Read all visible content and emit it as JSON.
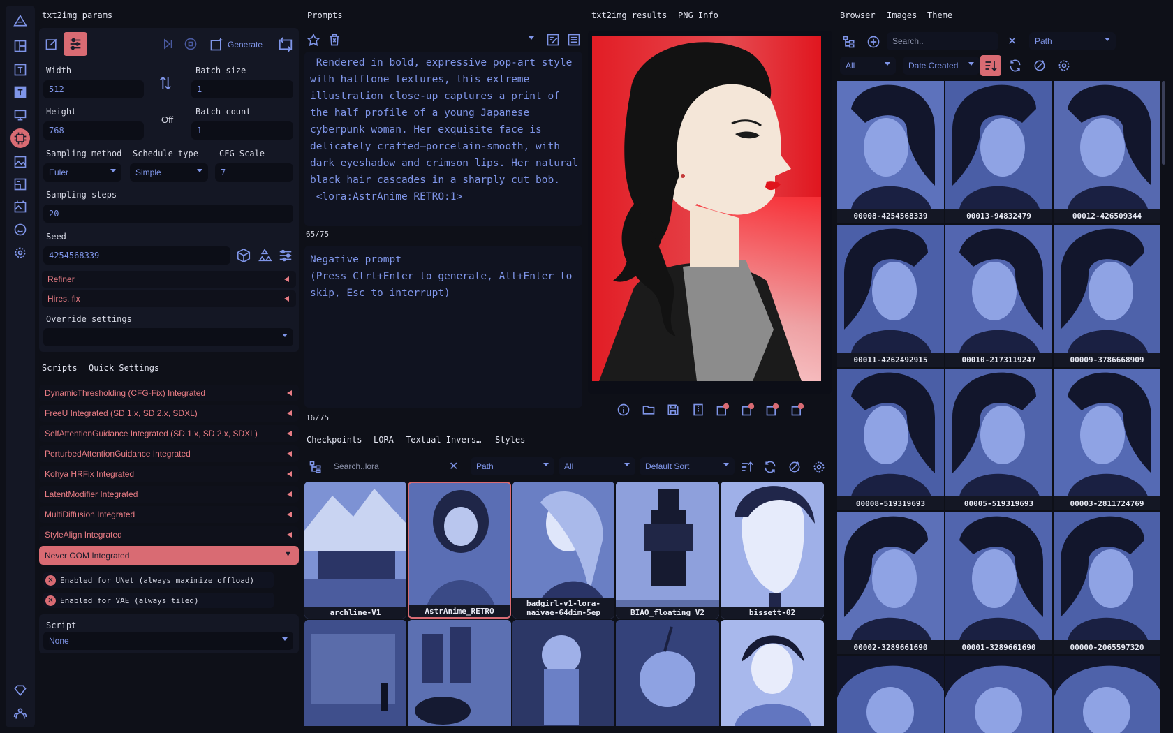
{
  "params": {
    "title": "txt2img params",
    "generate": "Generate",
    "width_label": "Width",
    "width": "512",
    "height_label": "Height",
    "height": "768",
    "batch_size_label": "Batch size",
    "batch_size": "1",
    "batch_count_label": "Batch count",
    "batch_count": "1",
    "swap_state": "Off",
    "sampling_method_label": "Sampling method",
    "sampling_method": "Euler",
    "schedule_type_label": "Schedule type",
    "schedule_type": "Simple",
    "cfg_label": "CFG Scale",
    "cfg": "7",
    "steps_label": "Sampling steps",
    "steps": "20",
    "seed_label": "Seed",
    "seed": "4254568339",
    "refiner": "Refiner",
    "hires": "Hires. fix",
    "override_label": "Override settings"
  },
  "scripts": {
    "tab_scripts": "Scripts",
    "tab_quick": "Quick Settings",
    "items": [
      "DynamicThresholding (CFG-Fix) Integrated",
      "FreeU Integrated (SD 1.x, SD 2.x, SDXL)",
      "SelfAttentionGuidance Integrated (SD 1.x, SD 2.x, SDXL)",
      "PerturbedAttentionGuidance Integrated",
      "Kohya HRFix Integrated",
      "LatentModifier Integrated",
      "MultiDiffusion Integrated",
      "StyleAlign Integrated"
    ],
    "open_item": "Never OOM Integrated",
    "opt_unet": "Enabled for UNet (always maximize offload)",
    "opt_vae": "Enabled for VAE (always tiled)",
    "script_label": "Script",
    "script_value": "None"
  },
  "prompts": {
    "title": "Prompts",
    "positive": " Rendered in bold, expressive pop-art style with halftone textures, this extreme illustration close-up captures a print of the half profile of a young Japanese cyberpunk woman. Her exquisite face is delicately crafted—porcelain-smooth, with dark eyeshadow and crimson lips. Her natural black hair cascades in a sharply cut bob.\n <lora:AstrAnime_RETRO:1>",
    "pos_count": "65/75",
    "negative": "Negative prompt\n(Press Ctrl+Enter to generate, Alt+Enter to skip, Esc to interrupt)",
    "neg_count": "16/75"
  },
  "results": {
    "tab_results": "txt2img results",
    "tab_png": "PNG Info"
  },
  "networks": {
    "tabs": [
      "Checkpoints",
      "LORA",
      "Textual Invers…",
      "Styles"
    ],
    "search_placeholder": "Search..lora",
    "path": "Path",
    "filter": "All",
    "sort": "Default Sort",
    "cards": [
      "archline-V1",
      "AstrAnime_RETRO",
      "badgirl-v1-lora-naivae-64dim-5ep",
      "BIAO_floating V2",
      "bissett-02"
    ]
  },
  "browser": {
    "tabs": [
      "Browser",
      "Images",
      "Theme"
    ],
    "search_placeholder": "Search..",
    "path": "Path",
    "filter": "All",
    "sort": "Date Created",
    "files": [
      "00008-4254568339",
      "00013-94832479",
      "00012-426509344",
      "00011-4262492915",
      "00010-2173119247",
      "00009-3786668909",
      "00008-519319693",
      "00005-519319693",
      "00003-2811724769",
      "00002-3289661690",
      "00001-3289661690",
      "00000-2065597320"
    ]
  },
  "colors": {
    "accent": "#d96b73",
    "text_blue": "#7f95e8",
    "panel": "#141724",
    "bg": "#0e1018"
  }
}
